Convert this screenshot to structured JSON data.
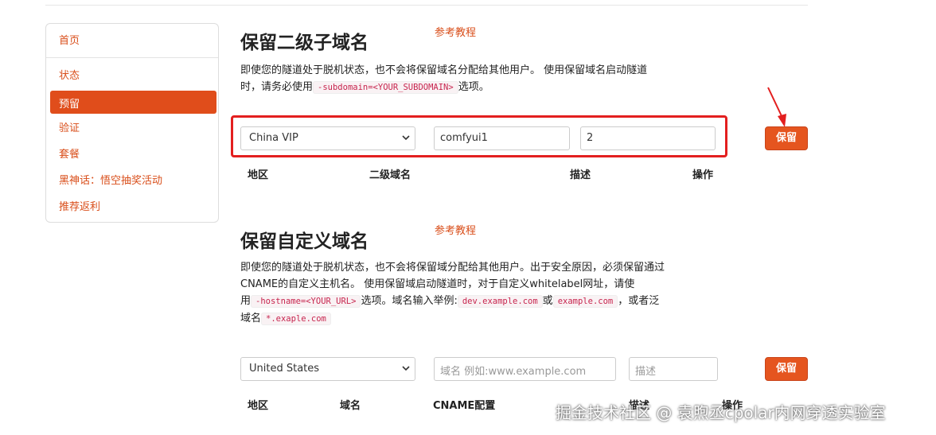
{
  "sidebar": {
    "items": [
      {
        "label": "首页"
      },
      {
        "label": "状态"
      },
      {
        "label": "预留"
      },
      {
        "label": "验证"
      },
      {
        "label": "套餐"
      },
      {
        "label": "黑神话：悟空抽奖活动"
      },
      {
        "label": "推荐返利"
      }
    ],
    "active_index": 2
  },
  "subdomain_section": {
    "title": "保留二级子域名",
    "tutorial_link": "参考教程",
    "desc_line1": "即使您的隧道处于脱机状态，也不会将保留域名分配给其他用户。 使用保留域名启动隧道",
    "desc_line2_a": "时，请务必使用",
    "desc_code": "-subdomain=<YOUR_SUBDOMAIN>",
    "desc_line2_b": "选项。",
    "form": {
      "region_value": "China VIP",
      "subdomain_value": "comfyui1",
      "description_value": "2",
      "save_label": "保留"
    },
    "columns": [
      "地区",
      "二级域名",
      "描述",
      "操作"
    ]
  },
  "custom_section": {
    "title": "保留自定义域名",
    "tutorial_link": "参考教程",
    "desc_line1": "即使您的隧道处于脱机状态，也不会将保留域分配给其他用户。出于安全原因，必须保留通过",
    "desc_line2": "CNAME的自定义主机名。 使用保留域启动隧道时，对于自定义whitelabel网址，请使",
    "desc_line3_a": "用",
    "desc_code_hostname": "-hostname=<YOUR_URL>",
    "desc_line3_b": "选项。域名输入举例:",
    "desc_code_example1": "dev.example.com",
    "desc_line3_c": "或",
    "desc_code_example2": "example.com",
    "desc_line3_d": "，或者泛",
    "desc_line4_a": "域名",
    "desc_code_wildcard": "*.exaple.com",
    "form": {
      "region_value": "United States",
      "domain_placeholder": "域名 例如:www.example.com",
      "description_placeholder": "描述",
      "save_label": "保留"
    },
    "columns": [
      "地区",
      "域名",
      "CNAME配置",
      "描述",
      "操作"
    ]
  },
  "watermark": "掘金技术社区 @ 袁煦丞cpolar内网穿透实验室",
  "colors": {
    "accent": "#e04d1b",
    "link": "#d94e1a",
    "highlight_box": "#e31f1f"
  }
}
